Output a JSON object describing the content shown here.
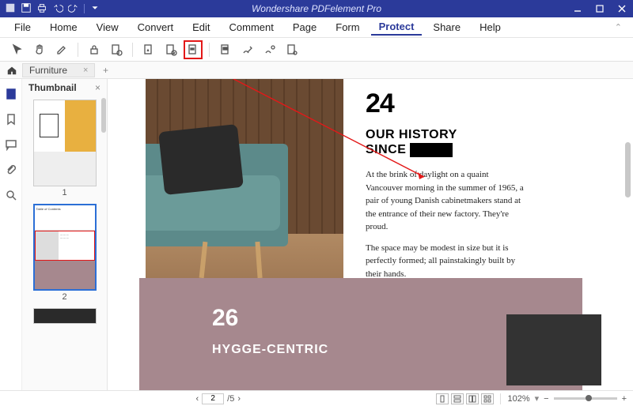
{
  "app_title": "Wondershare PDFelement Pro",
  "menu": {
    "file": "File",
    "home": "Home",
    "view": "View",
    "convert": "Convert",
    "edit": "Edit",
    "comment": "Comment",
    "page": "Page",
    "form": "Form",
    "protect": "Protect",
    "share": "Share",
    "help": "Help"
  },
  "active_menu": "protect",
  "tab": {
    "name": "Furniture",
    "close": "×",
    "add": "+"
  },
  "panel": {
    "title": "Thumbnail",
    "close": "×"
  },
  "thumbs": [
    {
      "n": "1"
    },
    {
      "n": "2"
    }
  ],
  "doc": {
    "top": {
      "num": "24",
      "head_line1": "OUR HISTORY",
      "head_line2": "SINCE",
      "p1": "At the brink of daylight on a quaint Vancouver morning in the summer of 1965, a pair of young Danish cabinetmakers stand at the entrance of their new factory. They're proud.",
      "p2": "The space may be modest in size but it is perfectly formed; all painstakingly built by their hands."
    },
    "bottom": {
      "num": "26",
      "head": "HYGGE-CENTRIC"
    }
  },
  "status": {
    "page_current": "2",
    "page_total": "/5",
    "zoom": "102%",
    "zoom_minus": "−",
    "zoom_plus": "+"
  },
  "thumb2_toc": "Table of Contents"
}
